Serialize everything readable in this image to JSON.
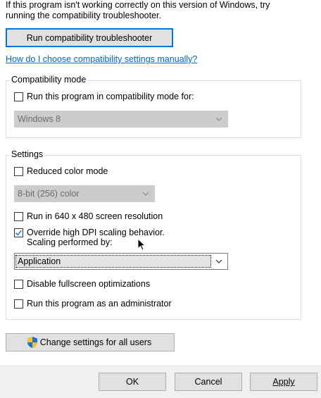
{
  "intro_text": "If this program isn't working correctly on this version of Windows, try running the compatibility troubleshooter.",
  "troubleshooter_button": "Run compatibility troubleshooter",
  "manual_link": "How do I choose compatibility settings manually?",
  "compat_mode": {
    "group_label": "Compatibility mode",
    "checkbox_label": "Run this program in compatibility mode for:",
    "checked": false,
    "dropdown_value": "Windows 8",
    "dropdown_enabled": false
  },
  "settings": {
    "group_label": "Settings",
    "reduced_color_label": "Reduced color mode",
    "reduced_color_checked": false,
    "color_dropdown_value": "8-bit (256) color",
    "res_label": "Run in 640 x 480 screen resolution",
    "res_checked": false,
    "dpi_label_line1": "Override high DPI scaling behavior.",
    "dpi_label_line2": "Scaling performed by:",
    "dpi_checked": true,
    "scaling_dropdown_value": "Application",
    "fullscreen_label": "Disable fullscreen optimizations",
    "fullscreen_checked": false,
    "admin_label": "Run this program as an administrator",
    "admin_checked": false
  },
  "change_all_users_button": "Change settings for all users",
  "footer": {
    "ok": "OK",
    "cancel": "Cancel",
    "apply": "Apply"
  },
  "icons": {
    "shield": "uac-shield-icon",
    "check": "checkmark-icon",
    "chevron": "chevron-down-icon",
    "cursor": "mouse-pointer-icon"
  },
  "colors": {
    "accent": "#0078d7",
    "link": "#0066cc",
    "button_bg": "#e1e1e1",
    "disabled_select": "#cccccc"
  }
}
